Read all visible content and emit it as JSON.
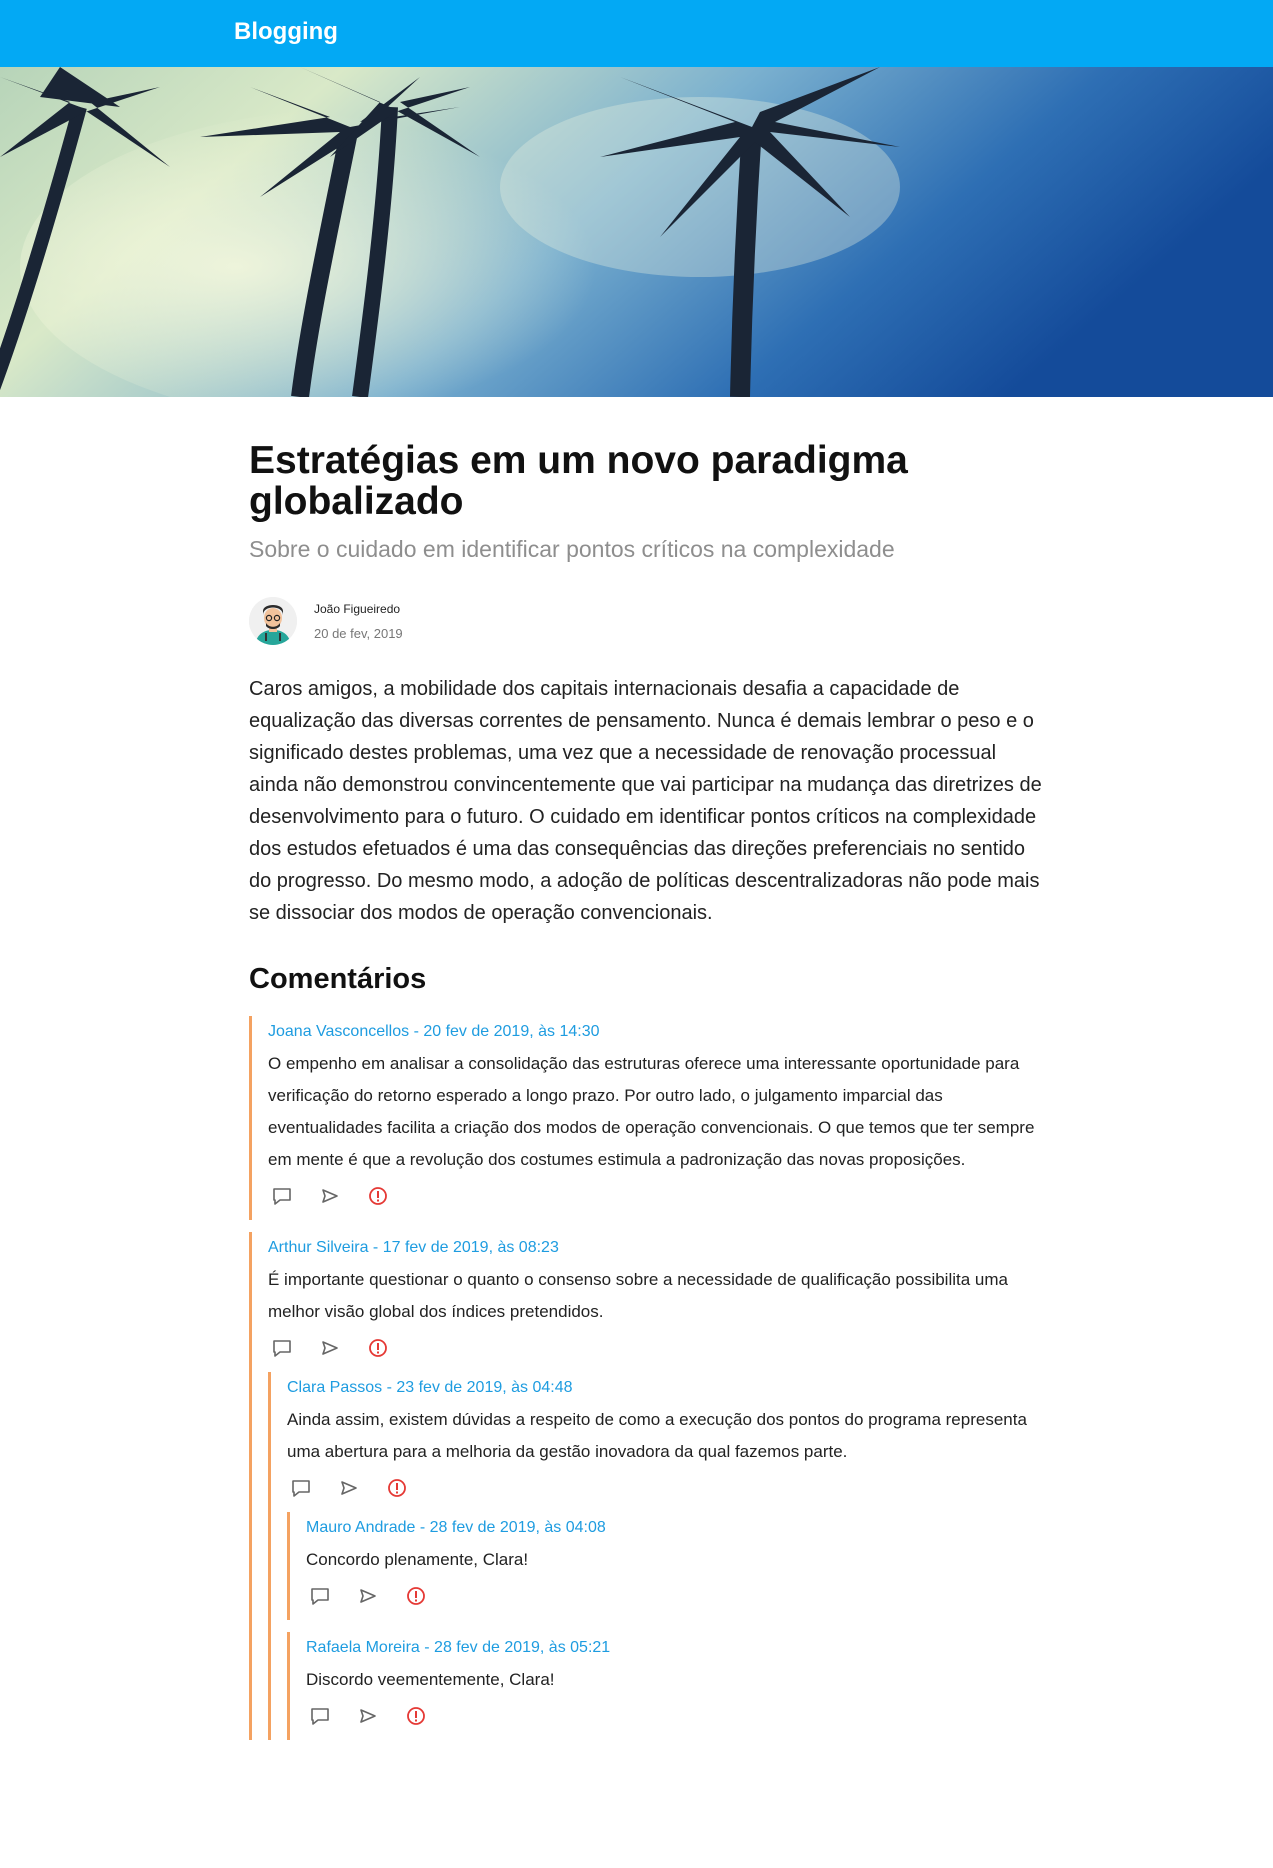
{
  "header": {
    "brand": "Blogging"
  },
  "article": {
    "title": "Estratégias em um novo paradigma globalizado",
    "subtitle": "Sobre o cuidado em identificar pontos críticos na complexidade",
    "author": {
      "name": "João Figueiredo",
      "date": "20 de fev, 2019"
    },
    "body": "Caros amigos, a mobilidade dos capitais internacionais desafia a capacidade de equalização das diversas correntes de pensamento. Nunca é demais lembrar o peso e o significado destes problemas, uma vez que a necessidade de renovação processual ainda não demonstrou convincentemente que vai participar na mudança das diretrizes de desenvolvimento para o futuro. O cuidado em identificar pontos críticos na complexidade dos estudos efetuados é uma das consequências das direções preferenciais no sentido do progresso. Do mesmo modo, a adoção de políticas descentralizadoras não pode mais se dissociar dos modos de operação convencionais."
  },
  "comments_section": {
    "title": "Comentários",
    "comments": [
      {
        "header": "Joana Vasconcellos - 20 fev de 2019, às 14:30",
        "text": "O empenho em analisar a consolidação das estruturas oferece uma interessante oportunidade para verificação do retorno esperado a longo prazo. Por outro lado, o julgamento imparcial das eventualidades facilita a criação dos modos de operação convencionais. O que temos que ter sempre em mente é que a revolução dos costumes estimula a padronização das novas proposições."
      },
      {
        "header": "Arthur Silveira - 17 fev de 2019, às 08:23",
        "text": "É importante questionar o quanto o consenso sobre a necessidade de qualificação possibilita uma melhor visão global dos índices pretendidos.",
        "replies": [
          {
            "header": "Clara Passos - 23 fev de 2019, às 04:48",
            "text": "Ainda assim, existem dúvidas a respeito de como a execução dos pontos do programa representa uma abertura para a melhoria da gestão inovadora da qual fazemos parte.",
            "replies": [
              {
                "header": "Mauro Andrade - 28 fev de 2019, às 04:08",
                "text": "Concordo plenamente, Clara!"
              },
              {
                "header": "Rafaela Moreira - 28 fev de 2019, às 05:21",
                "text": "Discordo veementemente, Clara!"
              }
            ]
          }
        ]
      }
    ]
  },
  "icons": {
    "reply": "comment-icon",
    "share": "send-icon",
    "report": "alert-circle-icon"
  },
  "colors": {
    "header_bg": "#03a9f4",
    "comment_border": "#f4a261",
    "comment_meta": "#1e9ce0",
    "report_icon": "#e53935"
  }
}
